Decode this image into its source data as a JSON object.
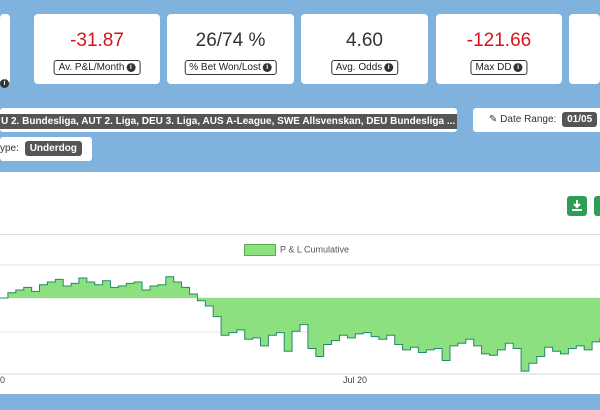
{
  "stats": [
    {
      "value": "-31.87",
      "label": "Av. P&L/Month",
      "negative": true
    },
    {
      "value": "26/74 %",
      "label": "% Bet Won/Lost",
      "negative": false
    },
    {
      "value": "4.60",
      "label": "Avg. Odds",
      "negative": false
    },
    {
      "value": "-121.66",
      "label": "Max DD",
      "negative": true
    }
  ],
  "filters": {
    "leagues_text": "U 2. Bundesliga, AUT 2. Liga, DEU 3. Liga, AUS A-League, SWE Allsvenskan, DEU Bundesliga ...",
    "remove_icon": "×",
    "date_range_label": "Date Range:",
    "date_range_value": "01/05",
    "bet_type_label": "ype:",
    "bet_type_value": "Underdog"
  },
  "chart_data": {
    "type": "area",
    "series": [
      {
        "name": "P & L Cumulative"
      }
    ],
    "x_tick_labels": [
      "0",
      "Jul 20"
    ],
    "legend_position": "top-center",
    "color": "#8ce07f",
    "line_color": "#238a6a",
    "y_range": [
      -80,
      20
    ],
    "values": [
      0,
      4,
      6,
      8,
      5,
      10,
      12,
      14,
      9,
      11,
      15,
      12,
      10,
      13,
      8,
      9,
      11,
      12,
      6,
      9,
      10,
      16,
      12,
      8,
      3,
      -2,
      -6,
      -14,
      -28,
      -26,
      -24,
      -31,
      -30,
      -36,
      -28,
      -26,
      -40,
      -25,
      -20,
      -38,
      -44,
      -35,
      -32,
      -28,
      -30,
      -27,
      -26,
      -29,
      -31,
      -28,
      -35,
      -39,
      -37,
      -41,
      -39,
      -38,
      -47,
      -36,
      -34,
      -31,
      -36,
      -42,
      -43,
      -39,
      -34,
      -38,
      -55,
      -49,
      -44,
      -37,
      -40,
      -42,
      -38,
      -36,
      -39,
      -33,
      -30
    ]
  }
}
